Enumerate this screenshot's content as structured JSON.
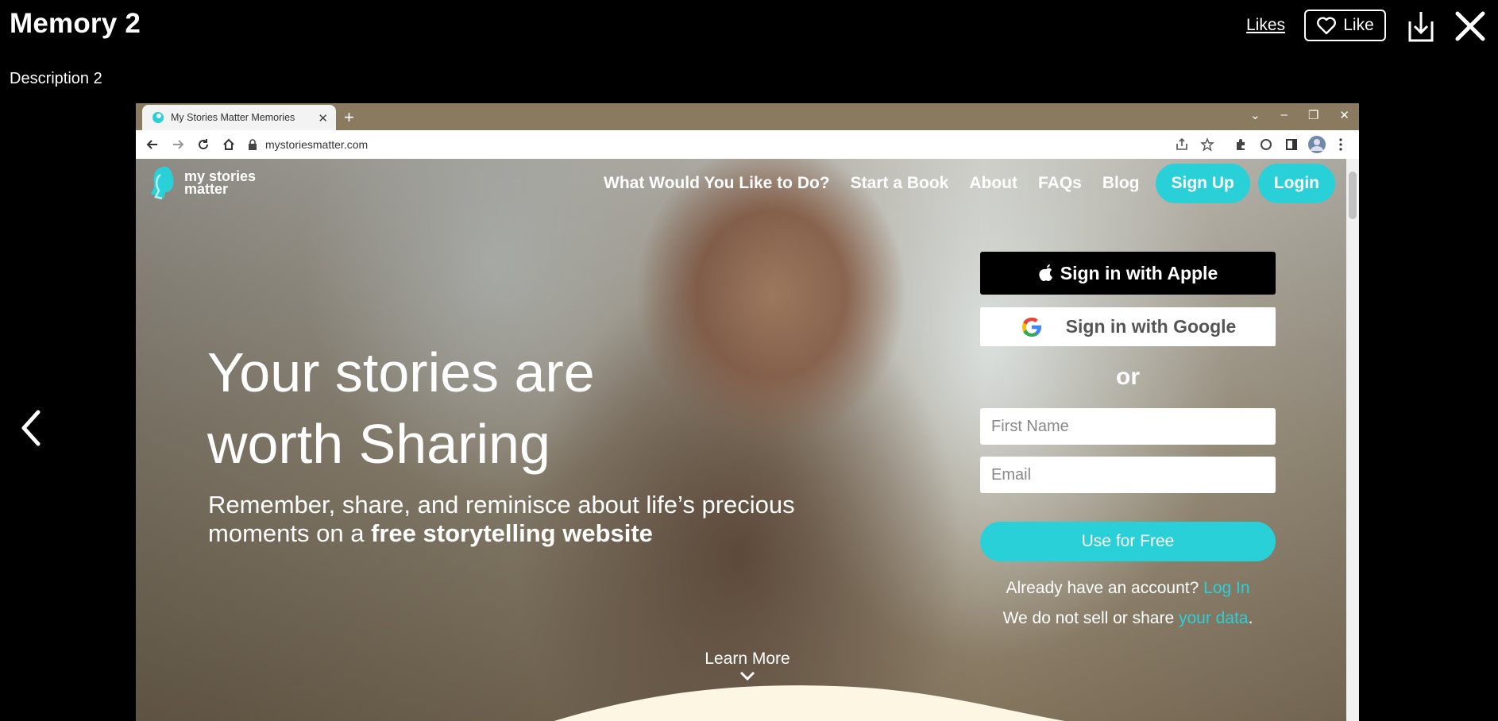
{
  "viewer": {
    "title": "Memory 2",
    "description": "Description 2",
    "likes_link": "Likes",
    "like_button": "Like",
    "icons": [
      "heart-icon",
      "download-icon",
      "close-icon",
      "chevron-left-icon"
    ]
  },
  "browser": {
    "tab_title": "My Stories Matter Memories",
    "url": "mystoriesmatter.com"
  },
  "site": {
    "logo_line1": "my stories",
    "logo_line2": "matter",
    "nav": {
      "what": "What Would You Like to Do?",
      "start": "Start a Book",
      "about": "About",
      "faqs": "FAQs",
      "blog": "Blog",
      "signup": "Sign Up",
      "login": "Login"
    },
    "headline_line1": "Your stories are",
    "headline_line2": "worth Sharing",
    "subline_line1": "Remember, share, and reminisce about life’s precious",
    "subline_line2_prefix": "moments on a ",
    "subline_line2_bold": "free storytelling website",
    "form": {
      "apple": "Sign in with Apple",
      "google": "Sign in with Google",
      "or": "or",
      "first_name_placeholder": "First Name",
      "email_placeholder": "Email",
      "submit": "Use for Free",
      "account_text": "Already have an account?",
      "account_link": "Log In",
      "privacy_text": "We do not sell or share",
      "privacy_link": "your data",
      "privacy_end": "."
    },
    "learn_more": "Learn More",
    "colors": {
      "accent": "#2ad0d8",
      "wave": "#fdf6e3"
    }
  }
}
